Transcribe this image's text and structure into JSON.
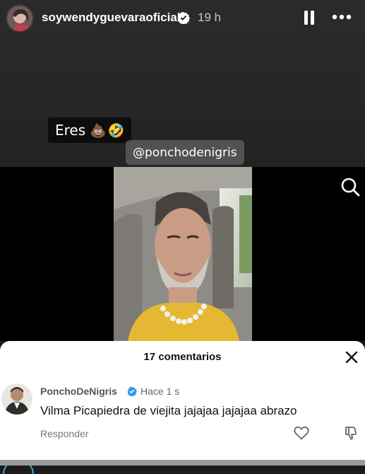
{
  "story": {
    "username": "soywendyguevaraoficial",
    "time": "19 h",
    "sticker_text": "Eres",
    "sticker_emoji": "💩🤣",
    "mention": "@ponchodenigris"
  },
  "comments_sheet": {
    "title": "17 comentarios",
    "comment": {
      "author": "PonchoDeNigris",
      "time": "Hace 1 s",
      "text": "Vilma Picapiedra de viejita jajajaa jajajaa abrazo",
      "reply_label": "Responder"
    }
  },
  "icons": {
    "verified": "verified-badge-icon",
    "pause": "pause-icon",
    "more": "more-icon",
    "search": "search-icon",
    "close": "close-icon",
    "like": "heart-icon",
    "dislike": "dislike-icon"
  },
  "colors": {
    "verified_blue": "#3897f0",
    "story_bg": "#262626",
    "sheet_bg": "#ffffff"
  }
}
